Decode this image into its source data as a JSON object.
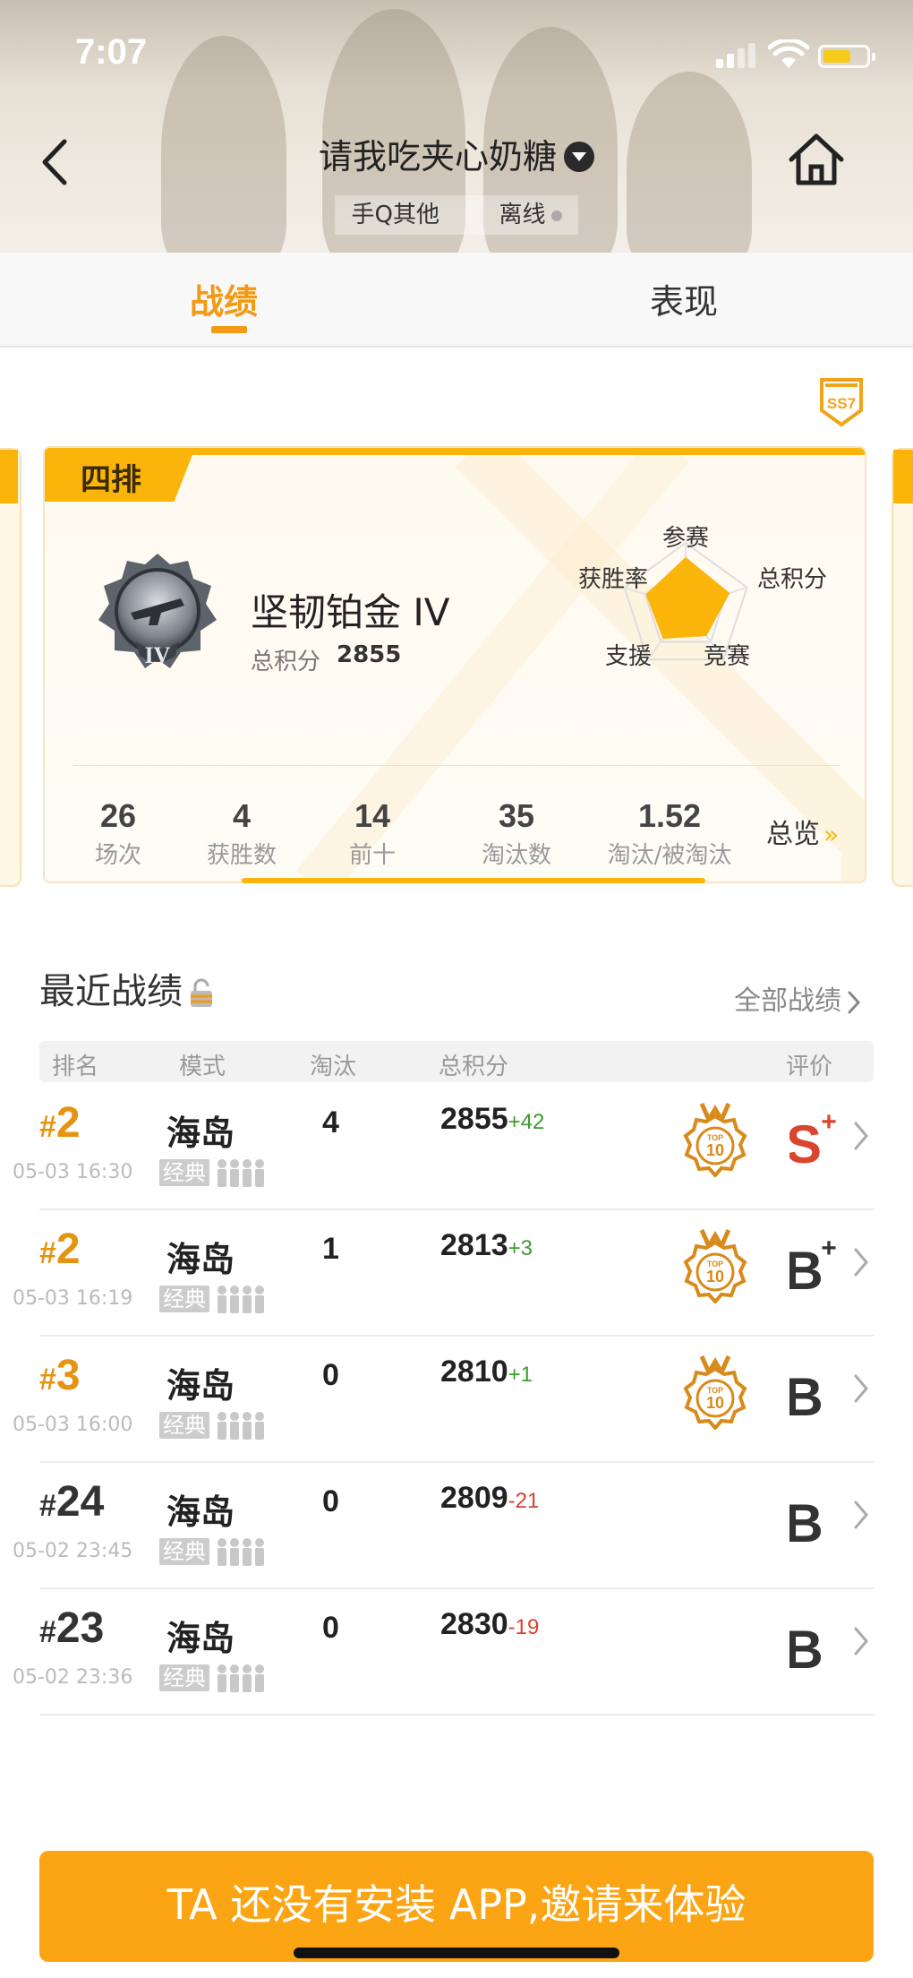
{
  "status_bar": {
    "time": "7:07"
  },
  "header": {
    "title": "请我吃夹心奶糖",
    "platform": "手Q其他",
    "online_status": "离线",
    "icons": {
      "back": "back-chevron-icon",
      "home": "home-icon",
      "dropdown": "dropdown-caret-icon"
    }
  },
  "tabs": [
    {
      "label": "战绩",
      "active": true
    },
    {
      "label": "表现",
      "active": false
    }
  ],
  "season": {
    "badge_text": "SS7"
  },
  "mode_card": {
    "mode": "四排",
    "rank_name": "坚韧铂金 IV",
    "rank_emblem_text": "IV",
    "total_score_label": "总积分",
    "total_score": "2855",
    "radar": {
      "labels": [
        "参赛",
        "总积分",
        "竞赛",
        "支援",
        "获胜率"
      ],
      "values": [
        0.78,
        0.72,
        0.55,
        0.6,
        0.65
      ]
    },
    "stats": [
      {
        "value": "26",
        "label": "场次"
      },
      {
        "value": "4",
        "label": "获胜数"
      },
      {
        "value": "14",
        "label": "前十"
      },
      {
        "value": "35",
        "label": "淘汰数"
      },
      {
        "value": "1.52",
        "label": "淘汰/被淘汰"
      }
    ],
    "overview_label": "总览",
    "accent_color": "#fbb40a"
  },
  "recent": {
    "title": "最近战绩",
    "all_link": "全部战绩",
    "columns": [
      "排名",
      "模式",
      "淘汰",
      "总积分",
      "评价"
    ],
    "rows": [
      {
        "rank": "2",
        "date": "05-03 16:30",
        "map": "海岛",
        "mode": "经典",
        "kills": "4",
        "score": "2855",
        "delta": "+42",
        "top10": true,
        "grade": "S+"
      },
      {
        "rank": "2",
        "date": "05-03 16:19",
        "map": "海岛",
        "mode": "经典",
        "kills": "1",
        "score": "2813",
        "delta": "+3",
        "top10": true,
        "grade": "B+"
      },
      {
        "rank": "3",
        "date": "05-03 16:00",
        "map": "海岛",
        "mode": "经典",
        "kills": "0",
        "score": "2810",
        "delta": "+1",
        "top10": true,
        "grade": "B"
      },
      {
        "rank": "24",
        "date": "05-02 23:45",
        "map": "海岛",
        "mode": "经典",
        "kills": "0",
        "score": "2809",
        "delta": "-21",
        "top10": false,
        "grade": "B"
      },
      {
        "rank": "23",
        "date": "05-02 23:36",
        "map": "海岛",
        "mode": "经典",
        "kills": "0",
        "score": "2830",
        "delta": "-19",
        "top10": false,
        "grade": "B"
      }
    ],
    "top10_badge_text": "TOP 10"
  },
  "cta": {
    "label": "TA 还没有安装 APP,邀请来体验"
  }
}
